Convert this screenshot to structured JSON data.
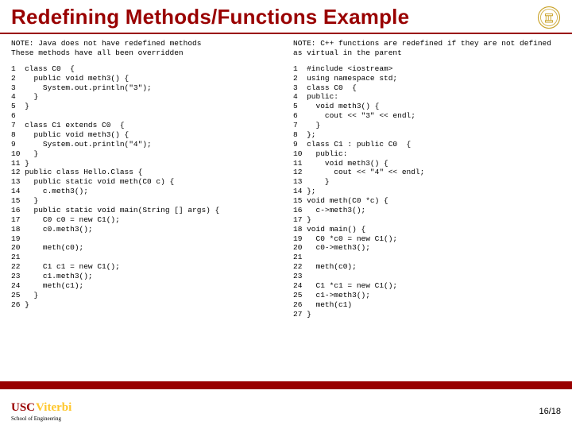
{
  "title": "Redefining Methods/Functions Example",
  "left": {
    "note": "NOTE: Java does not have redefined methods\nThese methods have all been overridden",
    "code": "1  class C0  {\n2    public void meth3() {\n3      System.out.println(\"3\");\n4    }\n5  }\n6\n7  class C1 extends C0  {\n8    public void meth3() {\n9      System.out.println(\"4\");\n10   }\n11 }\n12 public class Hello.Class {\n13   public static void meth(C0 c) {\n14     c.meth3();\n15   }\n16   public static void main(String [] args) {\n17     C0 c0 = new C1();\n18     c0.meth3();\n19\n20     meth(c0);\n21\n22     C1 c1 = new C1();\n23     c1.meth3();\n24     meth(c1);\n25   }\n26 }"
  },
  "right": {
    "note": "NOTE: C++ functions are redefined if they are not defined as virtual in the parent",
    "code": "1  #include <iostream>\n2  using namespace std;\n3  class C0  {\n4  public:\n5    void meth3() {\n6      cout << \"3\" << endl;\n7    }\n8  };\n9  class C1 : public C0  {\n10   public:\n11     void meth3() {\n12       cout << \"4\" << endl;\n13     }\n14 };\n15 void meth(C0 *c) {\n16   c->meth3();\n17 }\n18 void main() {\n19   C0 *c0 = new C1();\n20   c0->meth3();\n21\n22   meth(c0);\n23\n24   C1 *c1 = new C1();\n25   c1->meth3();\n26   meth(c1)\n27 }"
  },
  "footer": {
    "usc": "USC",
    "viterbi": "Viterbi",
    "school": "School of Engineering",
    "page": "16/18"
  }
}
